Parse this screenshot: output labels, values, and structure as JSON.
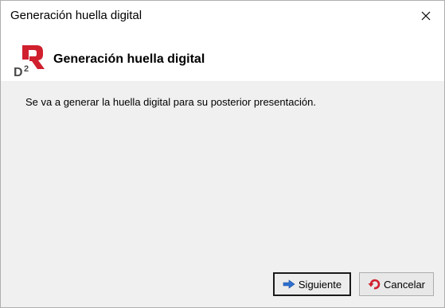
{
  "window": {
    "title": "Generación huella digital"
  },
  "header": {
    "title": "Generación huella digital",
    "logo_text": "D2"
  },
  "body": {
    "message": "Se va a generar la huella digital para su posterior presentación."
  },
  "buttons": {
    "next_label": "Siguiente",
    "cancel_label": "Cancelar"
  },
  "icons": {
    "close": "close-icon",
    "logo": "d2-logo-icon",
    "next": "arrow-right-icon",
    "cancel": "undo-icon"
  },
  "colors": {
    "brand_red": "#d0202e",
    "logo_gray": "#4a4a4a",
    "next_icon_blue": "#2d6fcf"
  }
}
